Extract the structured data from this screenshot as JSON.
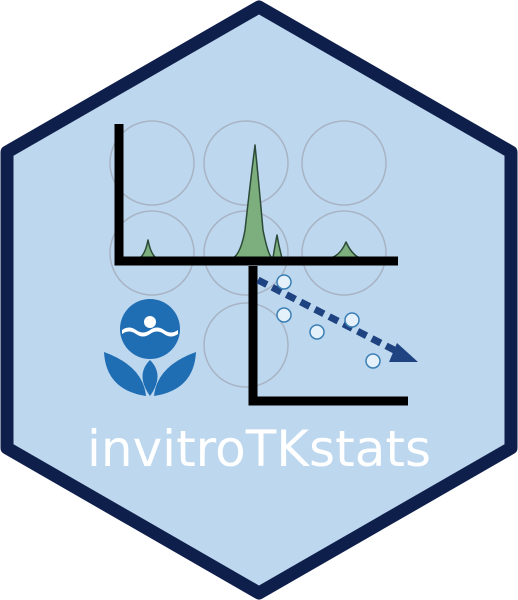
{
  "logo": {
    "package_name": "invitroTKstats",
    "emblem_icon": "epa-seal-icon",
    "colors": {
      "hex_fill": "#bdd7ee",
      "hex_border": "#0f1f4b",
      "circle_stroke": "#a8b4c4",
      "chromatogram_fill": "#7daf7e",
      "chromatogram_line": "#2c4a37",
      "axis": "#000000",
      "regression_line": "#1e4380",
      "data_point_fill": "#e4f1fb",
      "data_point_stroke": "#3a7fb5",
      "emblem_blue": "#1f6eb4",
      "title_text": "#ffffff"
    }
  }
}
